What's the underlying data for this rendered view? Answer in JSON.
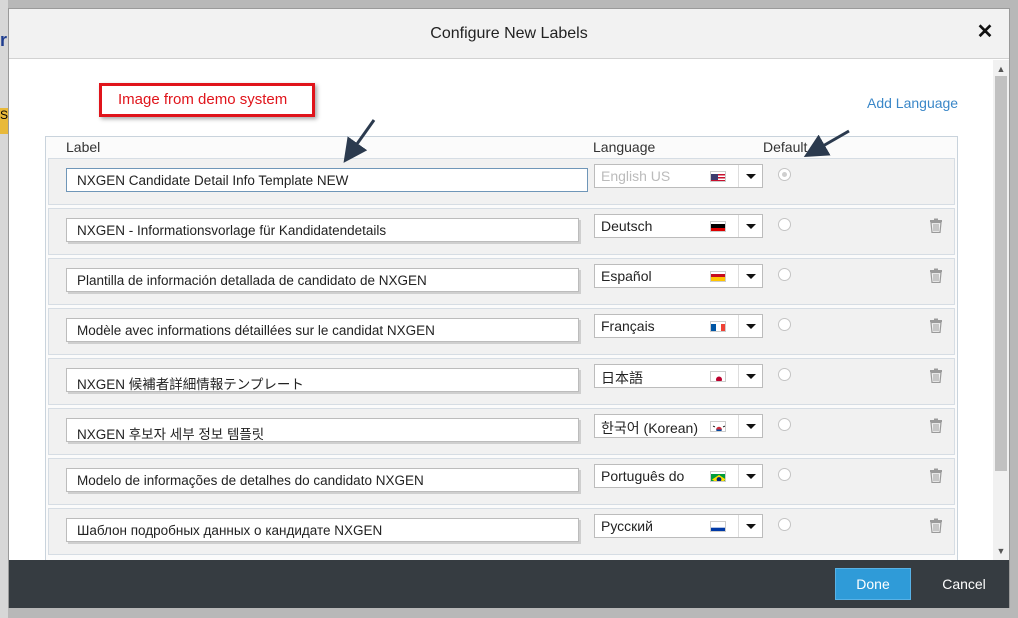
{
  "background": {
    "logo_fragment": "r",
    "yellow_fragment": "S"
  },
  "dialog": {
    "title": "Configure New Labels",
    "close_label": "✕",
    "annotation": "Image from demo system",
    "add_language": "Add Language",
    "columns": {
      "label": "Label",
      "language": "Language",
      "default": "Default"
    },
    "rows": [
      {
        "label": "NXGEN Candidate Detail Info Template NEW",
        "language": "English US",
        "flag": "us",
        "default": true
      },
      {
        "label": "NXGEN - Informationsvorlage für Kandidatendetails",
        "language": "Deutsch",
        "flag": "de",
        "default": false
      },
      {
        "label": "Plantilla de información detallada de candidato de NXGEN",
        "language": "Español",
        "flag": "es",
        "default": false
      },
      {
        "label": "Modèle avec informations détaillées sur le candidat NXGEN",
        "language": "Français",
        "flag": "fr",
        "default": false
      },
      {
        "label": "NXGEN 候補者詳細情報テンプレート",
        "language": "日本語",
        "flag": "jp",
        "default": false
      },
      {
        "label": "NXGEN 후보자 세부 정보 템플릿",
        "language": "한국어 (Korean)",
        "flag": "kr",
        "default": false
      },
      {
        "label": "Modelo de informações de detalhes do candidato NXGEN",
        "language": "Português do",
        "flag": "br",
        "default": false
      },
      {
        "label": "Шаблон подробных данных о кандидате NXGEN",
        "language": "Русский",
        "flag": "ru",
        "default": false
      }
    ],
    "footer": {
      "done": "Done",
      "cancel": "Cancel"
    }
  },
  "colors": {
    "accent": "#2f9bd8",
    "link": "#3a87c8",
    "annotation": "#e0141b",
    "footer": "#363c41"
  }
}
